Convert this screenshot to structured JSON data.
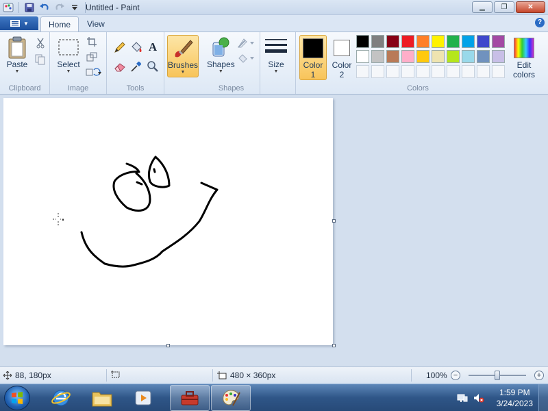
{
  "window": {
    "title": "Untitled - Paint",
    "minimize_label": "▁",
    "restore_label": "❐",
    "close_label": "✕"
  },
  "tabs": [
    {
      "label": "Home",
      "active": true
    },
    {
      "label": "View",
      "active": false
    }
  ],
  "help_label": "?",
  "ribbon": {
    "clipboard": {
      "label": "Clipboard",
      "paste": "Paste"
    },
    "image": {
      "label": "Image",
      "select": "Select"
    },
    "tools": {
      "label": "Tools"
    },
    "brushes": {
      "label": "Brushes"
    },
    "shapes": {
      "label": "Shapes",
      "shapes_btn": "Shapes"
    },
    "size": {
      "label": "Size"
    },
    "colors": {
      "label": "Colors",
      "color1_line1": "Color",
      "color1_line2": "1",
      "color2_line1": "Color",
      "color2_line2": "2",
      "edit_line1": "Edit",
      "edit_line2": "colors",
      "color1_value": "#000000",
      "color2_value": "#ffffff",
      "palette": [
        "#000000",
        "#7f7f7f",
        "#880015",
        "#ed1c24",
        "#ff7f27",
        "#fff200",
        "#22b14c",
        "#00a2e8",
        "#3f48cc",
        "#a349a4",
        "#ffffff",
        "#c3c3c3",
        "#b97a57",
        "#ffaec9",
        "#ffc90e",
        "#efe4b0",
        "#b5e61d",
        "#99d9ea",
        "#7092be",
        "#c8bfe7",
        "#f5f7fa",
        "#f5f7fa",
        "#f5f7fa",
        "#f5f7fa",
        "#f5f7fa",
        "#f5f7fa",
        "#f5f7fa",
        "#f5f7fa",
        "#f5f7fa",
        "#f5f7fa"
      ]
    }
  },
  "status": {
    "cursor_pos": "88, 180px",
    "canvas_size": "480 × 360px",
    "zoom": "100%",
    "zoom_minus": "−",
    "zoom_plus": "+"
  },
  "taskbar": {
    "time": "1:59 PM",
    "date": "3/24/2023"
  }
}
